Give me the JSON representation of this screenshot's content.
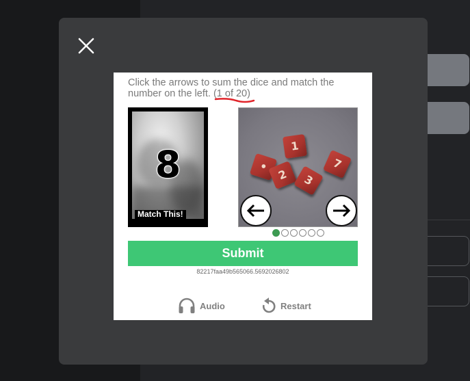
{
  "captcha": {
    "instructions": "Click the arrows to sum the dice and match the number on the left.",
    "counter": "(1 of 20)",
    "target_number": "8",
    "match_label": "Match This!",
    "dice_faces": [
      "1",
      "•",
      "2",
      "3",
      "7"
    ],
    "pagination": {
      "total": 6,
      "current": 1
    },
    "submit_label": "Submit",
    "session_id": "82217faa49b565066.5692026802",
    "audio_label": "Audio",
    "restart_label": "Restart",
    "accent_color": "#3ec775",
    "annotation_color": "#e0242a"
  },
  "icons": [
    "close-icon",
    "arrow-left-icon",
    "arrow-right-icon",
    "headphones-icon",
    "restart-icon"
  ]
}
